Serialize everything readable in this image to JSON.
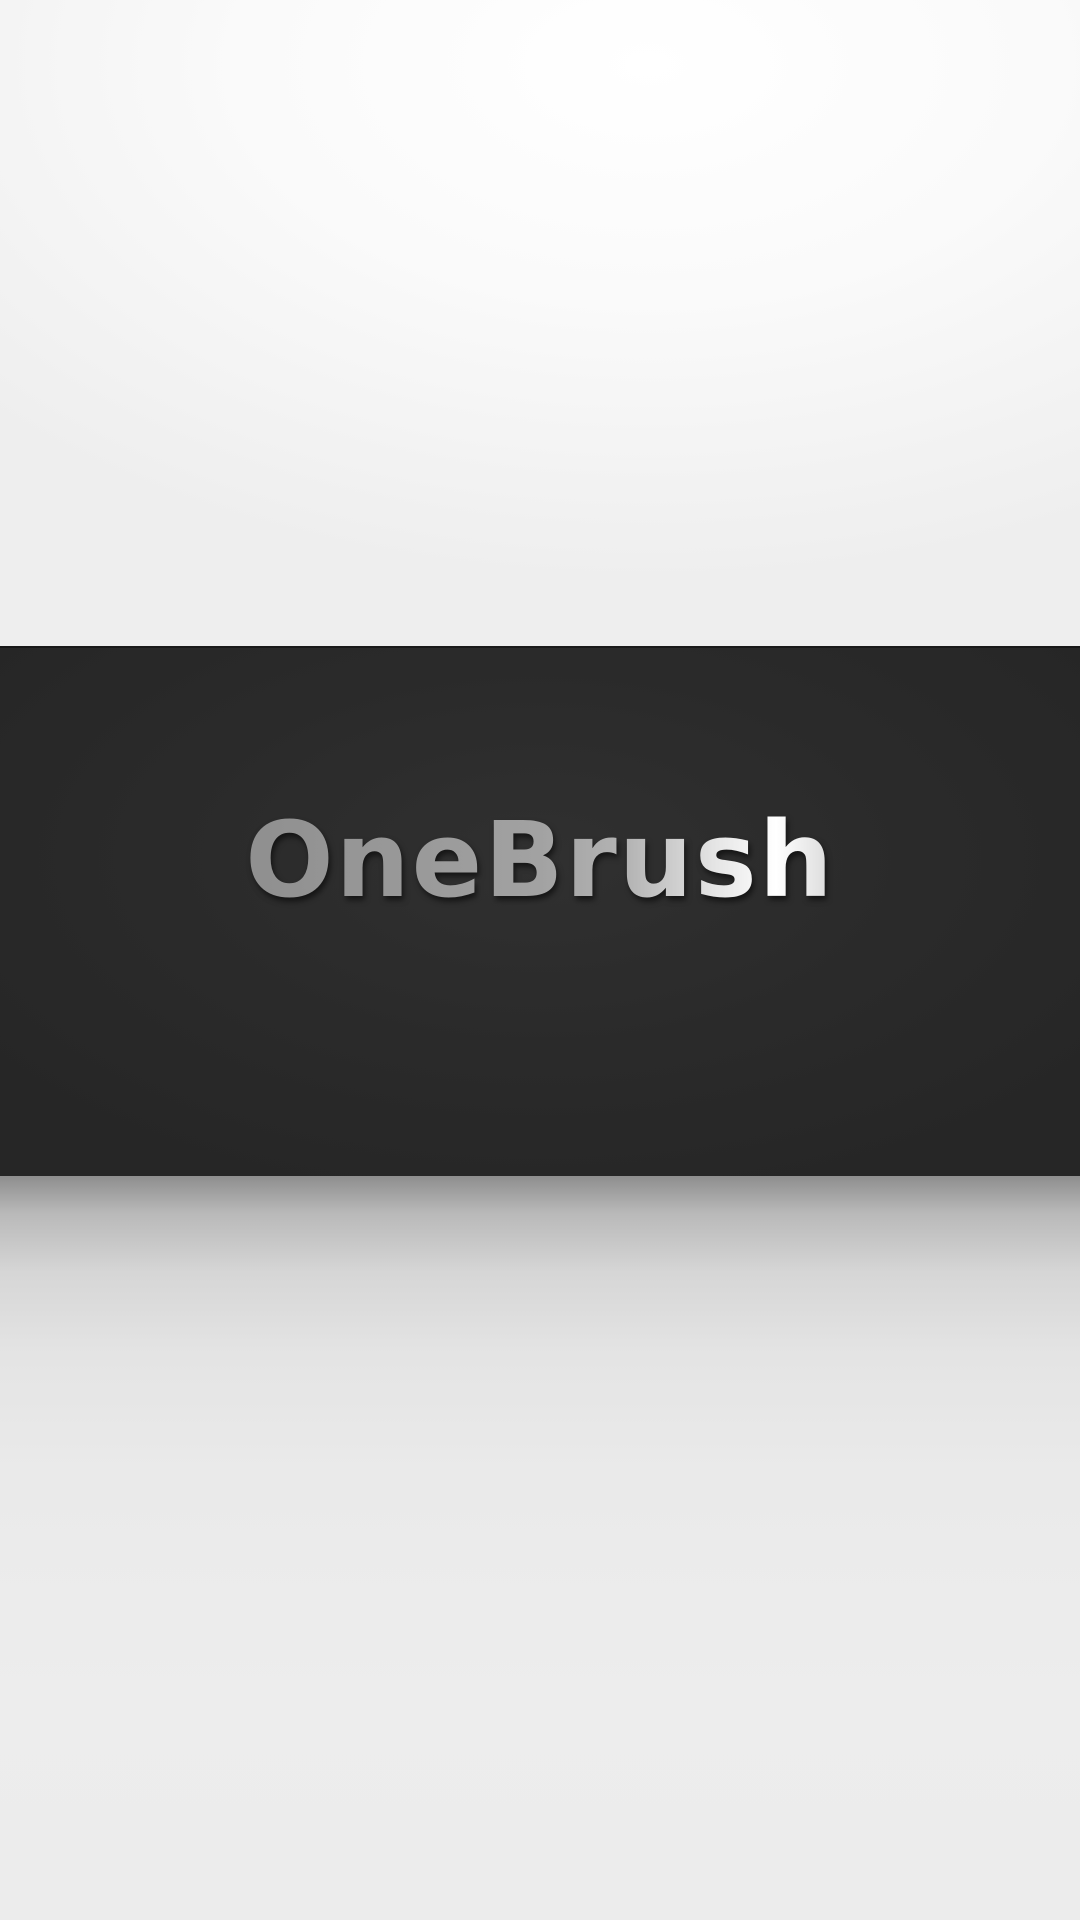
{
  "splash": {
    "app_name": "OneBrush"
  },
  "colors": {
    "band_background": "#2b2b2b",
    "page_background": "#ececec",
    "logo_silver": "#9e9e9e",
    "logo_highlight": "#ffffff"
  }
}
